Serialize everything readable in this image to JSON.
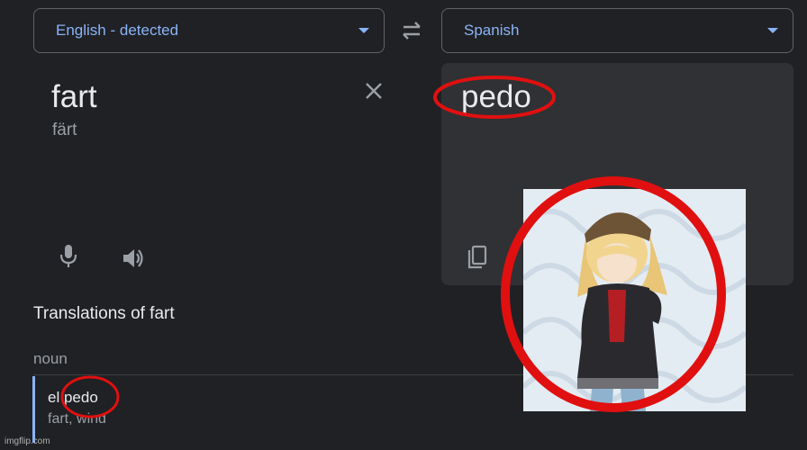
{
  "source": {
    "language": "English - detected",
    "text": "fart",
    "phonetic": "färt"
  },
  "target": {
    "language": "Spanish",
    "text": "pedo"
  },
  "dictionary": {
    "title": "Translations of fart",
    "part_of_speech": "noun",
    "entries": [
      {
        "word": "el pedo",
        "synonyms": "fart, wind"
      }
    ]
  },
  "watermark": "imgflip.com",
  "icons": [
    "chevron-down-icon",
    "swap-icon",
    "close-icon",
    "mic-icon",
    "speaker-icon",
    "copy-icon"
  ],
  "colors": {
    "background": "#202124",
    "panel": "#303134",
    "accent": "#8ab4f8",
    "annotation": "#e01010"
  }
}
